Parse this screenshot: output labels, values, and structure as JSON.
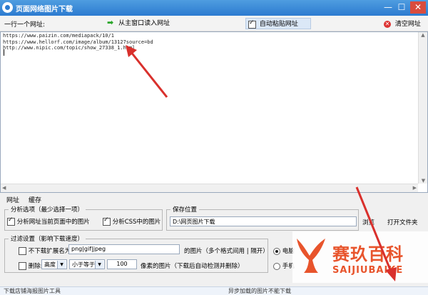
{
  "window": {
    "title": "页面网络图片下载",
    "min": "—",
    "max": "☐",
    "close": "✕"
  },
  "toolbar": {
    "hint": "一行一个网址:",
    "read_arrow": "➡",
    "read_label": "从主窗口读入网址",
    "autopaste_label": "自动粘贴网址",
    "autopaste_checked": true,
    "clear_label": "清空网址"
  },
  "urls": [
    "https://www.paizin.com/mediapack/10/1",
    "https://www.hellorf.com/image/album/13127source=bd",
    "http://www.nipic.com/topic/show_27338_1.html"
  ],
  "tabs": {
    "url_tab": "网址",
    "cache_tab": "缓存"
  },
  "analyze": {
    "title": "分析选项（最少选择一项）",
    "opt1": "分析网址当前页面中的图片",
    "opt1_checked": true,
    "opt2": "分析CSS中的图片",
    "opt2_checked": true
  },
  "save": {
    "title": "保存位置",
    "path": "D:\\网页图片下载",
    "browse": "浏览",
    "open": "打开文件夹"
  },
  "filter": {
    "title": "过滤设置（影响下载速度）",
    "ext_label": "不下载扩展名为:",
    "ext_value": "png|gif|jpeg",
    "ext_suffix": "的图片（多个格式间用 | 隔开）",
    "ext_checked": false,
    "del_label": "删除:",
    "del_checked": false,
    "dim_value": "高度",
    "cmp_value": "小于等于",
    "px_value": "100",
    "px_suffix": "像素的图片（下载后自动检测并删除）"
  },
  "mode": {
    "pc": "电脑",
    "phone": "手机",
    "pc_selected": true
  },
  "status": {
    "left": "下载店铺海报图片工具",
    "center": "异步加载的图片不能下载"
  },
  "watermark": {
    "cn": "赛玖百科",
    "en": "SAIJIUBAIKE"
  },
  "colors": {
    "titlebar": "#2c7bd0",
    "accent_red": "#e8542c",
    "arrow_red": "#d9302c"
  }
}
